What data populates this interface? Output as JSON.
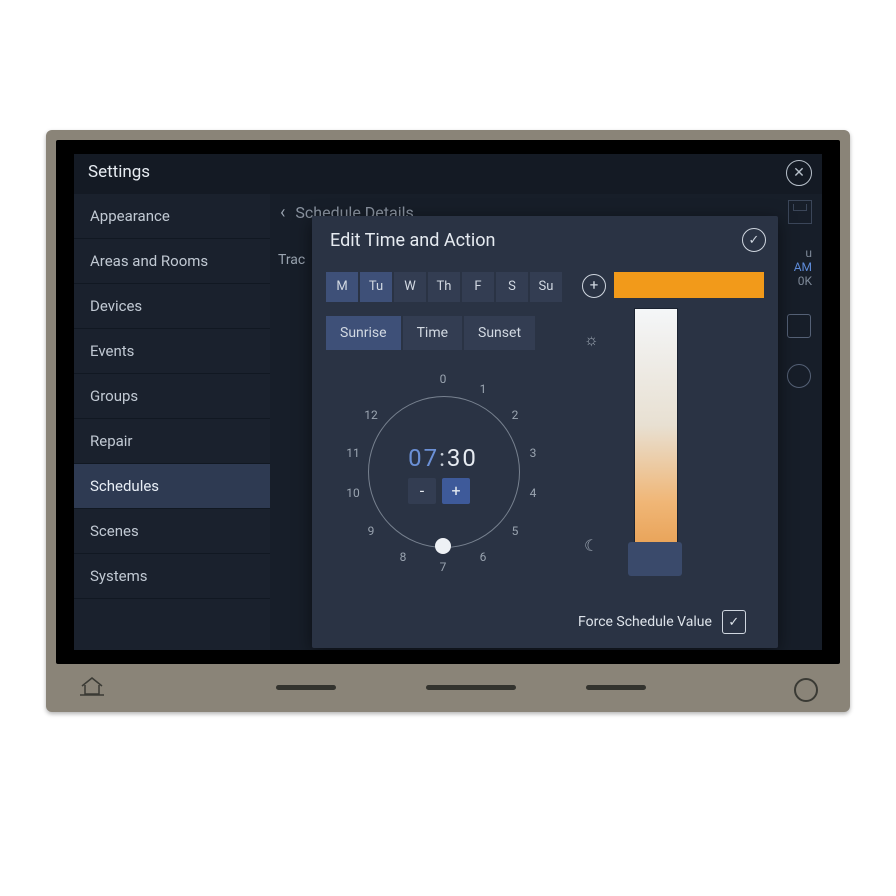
{
  "header": {
    "title": "Settings"
  },
  "sidebar": {
    "items": [
      {
        "label": "Appearance"
      },
      {
        "label": "Areas and Rooms"
      },
      {
        "label": "Devices"
      },
      {
        "label": "Events"
      },
      {
        "label": "Groups"
      },
      {
        "label": "Repair"
      },
      {
        "label": "Schedules"
      },
      {
        "label": "Scenes"
      },
      {
        "label": "Systems"
      }
    ],
    "active_index": 6
  },
  "content": {
    "breadcrumb_back": "‹",
    "breadcrumb_title": "Schedule Details",
    "background_tab": "Trac",
    "peek_line1": "u",
    "peek_line2": "AM",
    "peek_line3": "0K"
  },
  "modal": {
    "title": "Edit Time and Action",
    "confirm_glyph": "✓",
    "days": [
      {
        "label": "M",
        "selected": true
      },
      {
        "label": "Tu",
        "selected": true
      },
      {
        "label": "W",
        "selected": false
      },
      {
        "label": "Th",
        "selected": false
      },
      {
        "label": "F",
        "selected": false
      },
      {
        "label": "S",
        "selected": false
      },
      {
        "label": "Su",
        "selected": false
      }
    ],
    "time_modes": [
      {
        "label": "Sunrise",
        "selected": true
      },
      {
        "label": "Time",
        "selected": false
      },
      {
        "label": "Sunset",
        "selected": false
      }
    ],
    "clock": {
      "ticks": [
        "0",
        "1",
        "2",
        "3",
        "4",
        "5",
        "6",
        "7",
        "8",
        "9",
        "10",
        "11",
        "12"
      ],
      "hours": "07",
      "sep": ":",
      "minutes": "30",
      "minus": "-",
      "plus": "+"
    },
    "plus_glyph": "+",
    "swatch_color": "#f29a1a",
    "day_glyph": "☼",
    "night_glyph": "☾",
    "force_label": "Force Schedule Value",
    "force_checked": "✓"
  }
}
